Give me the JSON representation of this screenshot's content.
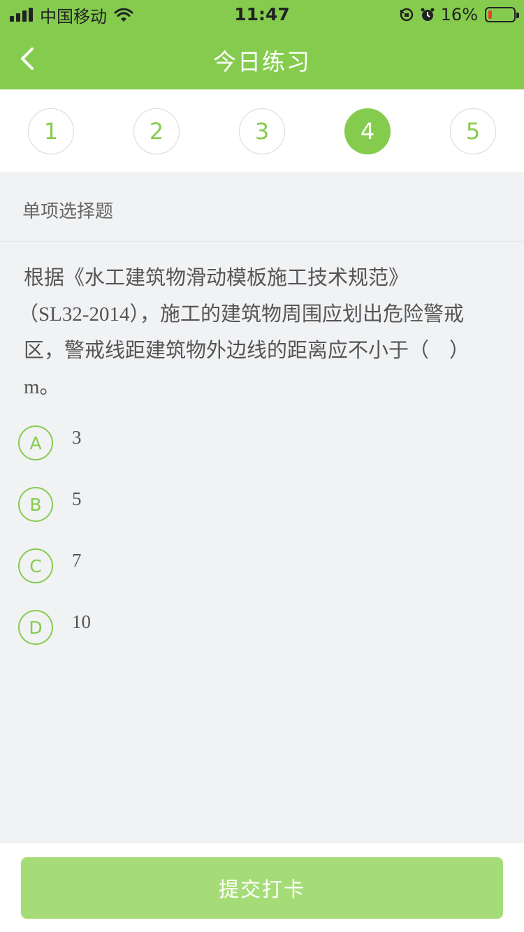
{
  "status_bar": {
    "carrier": "中国移动",
    "time": "11:47",
    "battery": "16%",
    "battery_level": 0.16
  },
  "nav": {
    "title": "今日练习",
    "back_icon": "chevron-left-icon"
  },
  "question_numbers": {
    "items": [
      "1",
      "2",
      "3",
      "4",
      "5"
    ],
    "active": "4"
  },
  "question": {
    "type": "单项选择题",
    "lines": [
      "根据《水工建筑物滑动模板施工技术规范》",
      "（SL32-2014），施工的建筑物周围应划出危险警戒",
      "区，警戒线距建筑物外边线的距离应不小于（　）",
      "m。"
    ],
    "options": [
      {
        "letter": "A",
        "text": "3"
      },
      {
        "letter": "B",
        "text": "5"
      },
      {
        "letter": "C",
        "text": "7"
      },
      {
        "letter": "D",
        "text": "10"
      }
    ]
  },
  "footer": {
    "submit_label": "提交打卡"
  },
  "colors": {
    "accent": "#85cc4e",
    "submit_disabled": "#a6dc78",
    "background": "#f1f2f4"
  }
}
